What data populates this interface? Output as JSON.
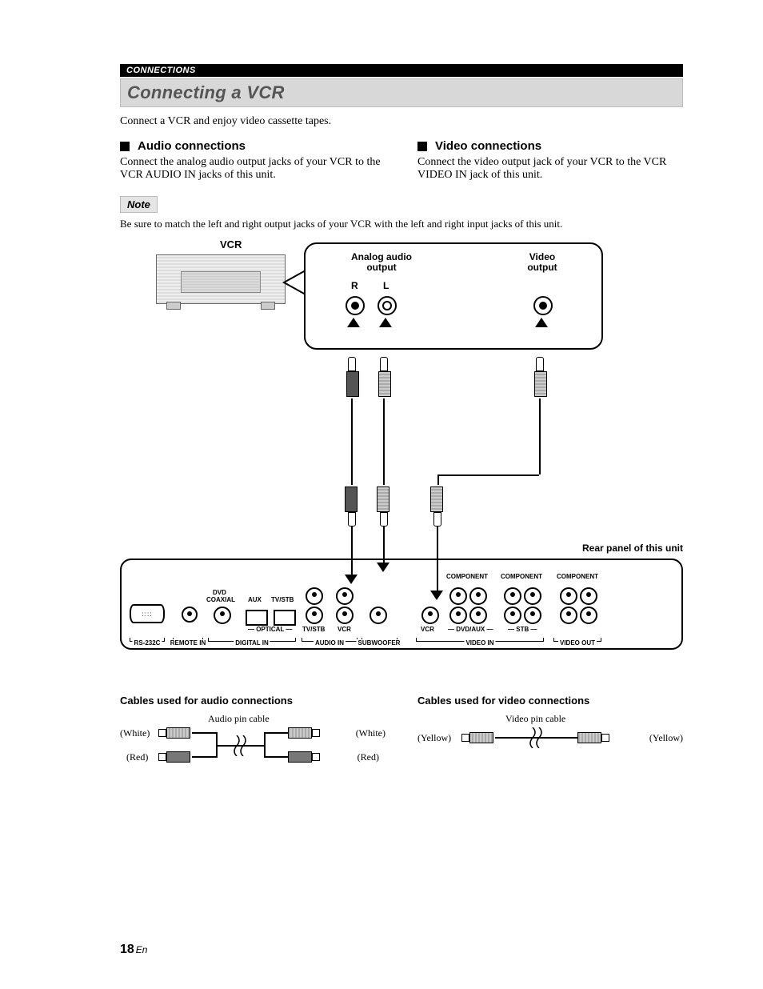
{
  "header": {
    "section": "CONNECTIONS"
  },
  "title": "Connecting a VCR",
  "intro": "Connect a VCR and enjoy video cassette tapes.",
  "audio": {
    "heading": "Audio connections",
    "body": "Connect the analog audio output jacks of your VCR to the VCR AUDIO IN jacks of this unit."
  },
  "video": {
    "heading": "Video connections",
    "body": "Connect the video output jack of your VCR to the VCR VIDEO IN jack of this unit."
  },
  "note": {
    "label": "Note",
    "text": "Be sure to match the left and right output jacks of your VCR with the left and right input jacks of this unit."
  },
  "diagram": {
    "vcr_label": "VCR",
    "analog_label_line1": "Analog audio",
    "analog_label_line2": "output",
    "chan_r": "R",
    "chan_l": "L",
    "video_label_line1": "Video",
    "video_label_line2": "output",
    "rear_label": "Rear panel of this unit",
    "panel": {
      "component": "COMPONENT",
      "dvd_coaxial_1": "DVD",
      "dvd_coaxial_2": "COAXIAL",
      "aux": "AUX",
      "tvstb": "TV/STB",
      "tvstb2": "TV/STB",
      "vcr": "VCR",
      "vcr2": "VCR",
      "dvdaux": "DVD/AUX",
      "stb": "STB",
      "rs232c": "RS-232C",
      "remotein": "REMOTE IN",
      "digitalin": "DIGITAL IN",
      "optical": "OPTICAL",
      "audioin": "AUDIO IN",
      "subwoofer": "SUBWOOFER",
      "videoin": "VIDEO IN",
      "videoout": "VIDEO OUT"
    }
  },
  "cables": {
    "audio": {
      "heading": "Cables used for audio connections",
      "pin_label": "Audio pin cable",
      "white": "(White)",
      "red": "(Red)"
    },
    "video": {
      "heading": "Cables used for video connections",
      "pin_label": "Video pin cable",
      "yellow": "(Yellow)"
    }
  },
  "page": {
    "number": "18",
    "lang": "En"
  }
}
